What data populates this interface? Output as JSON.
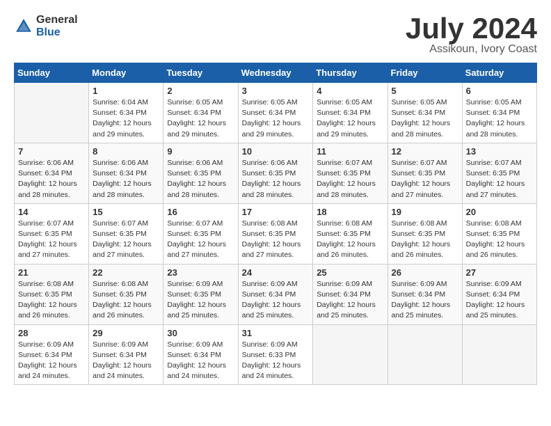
{
  "header": {
    "logo_general": "General",
    "logo_blue": "Blue",
    "month_title": "July 2024",
    "location": "Assikoun, Ivory Coast"
  },
  "weekdays": [
    "Sunday",
    "Monday",
    "Tuesday",
    "Wednesday",
    "Thursday",
    "Friday",
    "Saturday"
  ],
  "weeks": [
    [
      {
        "day": "",
        "info": ""
      },
      {
        "day": "1",
        "info": "Sunrise: 6:04 AM\nSunset: 6:34 PM\nDaylight: 12 hours\nand 29 minutes."
      },
      {
        "day": "2",
        "info": "Sunrise: 6:05 AM\nSunset: 6:34 PM\nDaylight: 12 hours\nand 29 minutes."
      },
      {
        "day": "3",
        "info": "Sunrise: 6:05 AM\nSunset: 6:34 PM\nDaylight: 12 hours\nand 29 minutes."
      },
      {
        "day": "4",
        "info": "Sunrise: 6:05 AM\nSunset: 6:34 PM\nDaylight: 12 hours\nand 29 minutes."
      },
      {
        "day": "5",
        "info": "Sunrise: 6:05 AM\nSunset: 6:34 PM\nDaylight: 12 hours\nand 28 minutes."
      },
      {
        "day": "6",
        "info": "Sunrise: 6:05 AM\nSunset: 6:34 PM\nDaylight: 12 hours\nand 28 minutes."
      }
    ],
    [
      {
        "day": "7",
        "info": "Sunrise: 6:06 AM\nSunset: 6:34 PM\nDaylight: 12 hours\nand 28 minutes."
      },
      {
        "day": "8",
        "info": "Sunrise: 6:06 AM\nSunset: 6:34 PM\nDaylight: 12 hours\nand 28 minutes."
      },
      {
        "day": "9",
        "info": "Sunrise: 6:06 AM\nSunset: 6:35 PM\nDaylight: 12 hours\nand 28 minutes."
      },
      {
        "day": "10",
        "info": "Sunrise: 6:06 AM\nSunset: 6:35 PM\nDaylight: 12 hours\nand 28 minutes."
      },
      {
        "day": "11",
        "info": "Sunrise: 6:07 AM\nSunset: 6:35 PM\nDaylight: 12 hours\nand 28 minutes."
      },
      {
        "day": "12",
        "info": "Sunrise: 6:07 AM\nSunset: 6:35 PM\nDaylight: 12 hours\nand 27 minutes."
      },
      {
        "day": "13",
        "info": "Sunrise: 6:07 AM\nSunset: 6:35 PM\nDaylight: 12 hours\nand 27 minutes."
      }
    ],
    [
      {
        "day": "14",
        "info": "Sunrise: 6:07 AM\nSunset: 6:35 PM\nDaylight: 12 hours\nand 27 minutes."
      },
      {
        "day": "15",
        "info": "Sunrise: 6:07 AM\nSunset: 6:35 PM\nDaylight: 12 hours\nand 27 minutes."
      },
      {
        "day": "16",
        "info": "Sunrise: 6:07 AM\nSunset: 6:35 PM\nDaylight: 12 hours\nand 27 minutes."
      },
      {
        "day": "17",
        "info": "Sunrise: 6:08 AM\nSunset: 6:35 PM\nDaylight: 12 hours\nand 27 minutes."
      },
      {
        "day": "18",
        "info": "Sunrise: 6:08 AM\nSunset: 6:35 PM\nDaylight: 12 hours\nand 26 minutes."
      },
      {
        "day": "19",
        "info": "Sunrise: 6:08 AM\nSunset: 6:35 PM\nDaylight: 12 hours\nand 26 minutes."
      },
      {
        "day": "20",
        "info": "Sunrise: 6:08 AM\nSunset: 6:35 PM\nDaylight: 12 hours\nand 26 minutes."
      }
    ],
    [
      {
        "day": "21",
        "info": "Sunrise: 6:08 AM\nSunset: 6:35 PM\nDaylight: 12 hours\nand 26 minutes."
      },
      {
        "day": "22",
        "info": "Sunrise: 6:08 AM\nSunset: 6:35 PM\nDaylight: 12 hours\nand 26 minutes."
      },
      {
        "day": "23",
        "info": "Sunrise: 6:09 AM\nSunset: 6:35 PM\nDaylight: 12 hours\nand 25 minutes."
      },
      {
        "day": "24",
        "info": "Sunrise: 6:09 AM\nSunset: 6:34 PM\nDaylight: 12 hours\nand 25 minutes."
      },
      {
        "day": "25",
        "info": "Sunrise: 6:09 AM\nSunset: 6:34 PM\nDaylight: 12 hours\nand 25 minutes."
      },
      {
        "day": "26",
        "info": "Sunrise: 6:09 AM\nSunset: 6:34 PM\nDaylight: 12 hours\nand 25 minutes."
      },
      {
        "day": "27",
        "info": "Sunrise: 6:09 AM\nSunset: 6:34 PM\nDaylight: 12 hours\nand 25 minutes."
      }
    ],
    [
      {
        "day": "28",
        "info": "Sunrise: 6:09 AM\nSunset: 6:34 PM\nDaylight: 12 hours\nand 24 minutes."
      },
      {
        "day": "29",
        "info": "Sunrise: 6:09 AM\nSunset: 6:34 PM\nDaylight: 12 hours\nand 24 minutes."
      },
      {
        "day": "30",
        "info": "Sunrise: 6:09 AM\nSunset: 6:34 PM\nDaylight: 12 hours\nand 24 minutes."
      },
      {
        "day": "31",
        "info": "Sunrise: 6:09 AM\nSunset: 6:33 PM\nDaylight: 12 hours\nand 24 minutes."
      },
      {
        "day": "",
        "info": ""
      },
      {
        "day": "",
        "info": ""
      },
      {
        "day": "",
        "info": ""
      }
    ]
  ]
}
